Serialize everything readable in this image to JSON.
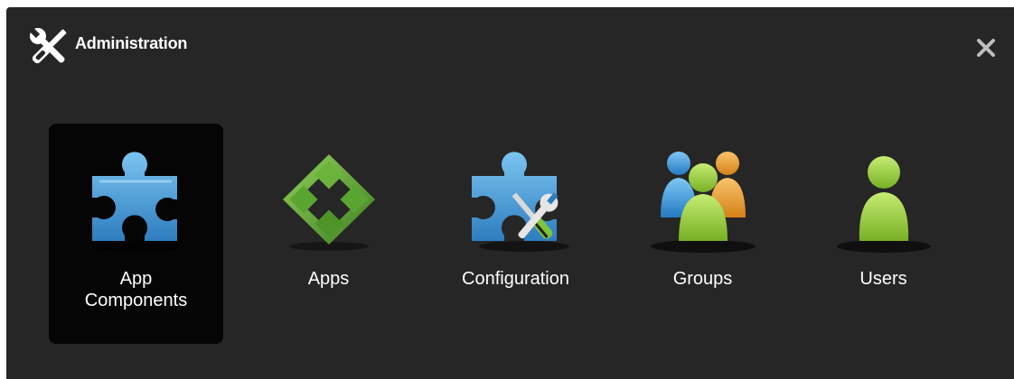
{
  "dialog": {
    "title": "Administration",
    "title_icon": "wrench-screwdriver-icon",
    "close_icon": "close-icon"
  },
  "items": [
    {
      "label": "App\nComponents",
      "icon": "puzzle-piece-icon",
      "selected": true
    },
    {
      "label": "Apps",
      "icon": "green-diamond-apps-icon",
      "selected": false
    },
    {
      "label": "Configuration",
      "icon": "puzzle-wrench-screwdriver-icon",
      "selected": false
    },
    {
      "label": "Groups",
      "icon": "people-group-icon",
      "selected": false
    },
    {
      "label": "Users",
      "icon": "user-icon",
      "selected": false
    }
  ],
  "colors": {
    "panel_bg": "#262626",
    "selected_bg": "#050505",
    "puzzle_blue": "#4a9fd8",
    "apps_green": "#5aa531",
    "user_green": "#9ccf3c",
    "user_blue": "#3d9fe0",
    "user_orange": "#f0a030"
  }
}
